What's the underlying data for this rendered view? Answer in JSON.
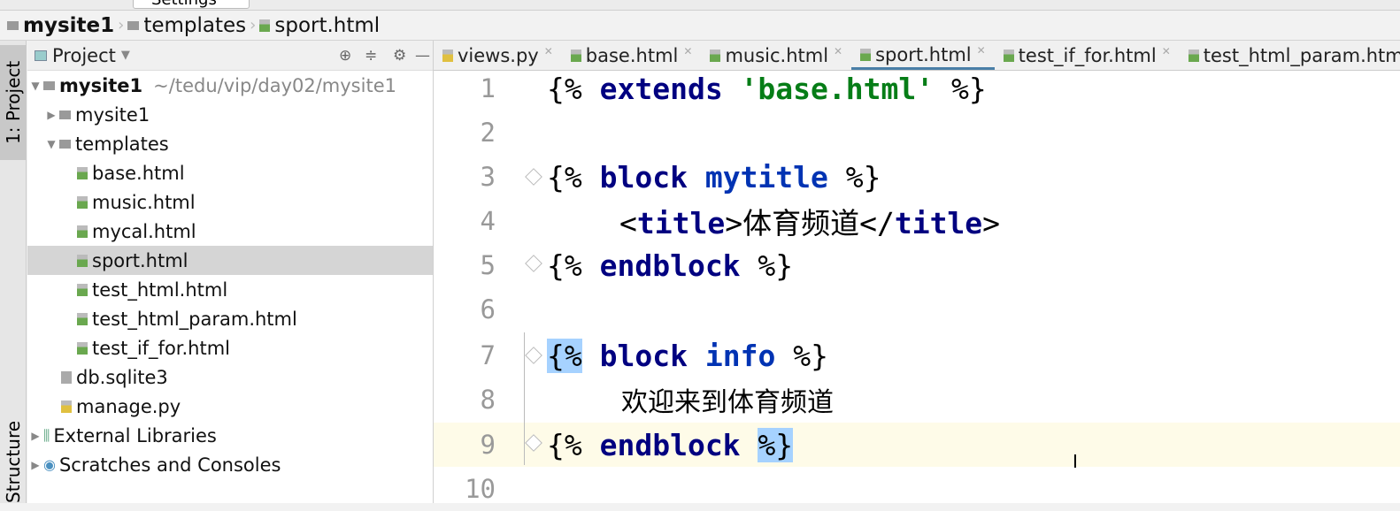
{
  "toolbar": {
    "run_config": "Settings"
  },
  "breadcrumb": [
    "mysite1",
    "templates",
    "sport.html"
  ],
  "sidebar_tabs": {
    "project": "1: Project",
    "structure": "Structure"
  },
  "project_panel": {
    "title": "Project",
    "root": {
      "name": "mysite1",
      "path": "~/tedu/vip/day02/mysite1"
    },
    "items": [
      {
        "label": "mysite1",
        "type": "folder",
        "level": 1,
        "expanded": false
      },
      {
        "label": "templates",
        "type": "folder",
        "level": 1,
        "expanded": true
      },
      {
        "label": "base.html",
        "type": "html",
        "level": 2
      },
      {
        "label": "music.html",
        "type": "html",
        "level": 2
      },
      {
        "label": "mycal.html",
        "type": "html",
        "level": 2
      },
      {
        "label": "sport.html",
        "type": "html",
        "level": 2,
        "selected": true
      },
      {
        "label": "test_html.html",
        "type": "html",
        "level": 2
      },
      {
        "label": "test_html_param.html",
        "type": "html",
        "level": 2
      },
      {
        "label": "test_if_for.html",
        "type": "html",
        "level": 2
      },
      {
        "label": "db.sqlite3",
        "type": "file",
        "level": 1
      },
      {
        "label": "manage.py",
        "type": "python",
        "level": 1
      }
    ],
    "extra": [
      "External Libraries",
      "Scratches and Consoles"
    ]
  },
  "tabs": [
    {
      "label": "views.py"
    },
    {
      "label": "base.html"
    },
    {
      "label": "music.html"
    },
    {
      "label": "sport.html",
      "active": true
    },
    {
      "label": "test_if_for.html"
    },
    {
      "label": "test_html_param.html"
    }
  ],
  "editor": {
    "current_line": 9,
    "line_numbers": [
      "1",
      "2",
      "3",
      "4",
      "5",
      "6",
      "7",
      "8",
      "9",
      "10"
    ],
    "l1": {
      "a": "{% ",
      "b": "extends",
      "c": " ",
      "d": "'base.html'",
      "e": " %}"
    },
    "l3": {
      "a": "{% ",
      "b": "block",
      "c": " ",
      "d": "mytitle",
      "e": " %}"
    },
    "l4": {
      "a": "<",
      "b": "title",
      "c": ">体育频道</",
      "d": "title",
      "e": ">"
    },
    "l5": {
      "a": "{% ",
      "b": "endblock",
      "c": " %}"
    },
    "l7": {
      "a": "{%",
      "b": " ",
      "c": "block",
      "d": " ",
      "e": "info",
      "f": " %}"
    },
    "l8": "欢迎来到体育频道",
    "l9": {
      "a": "{% ",
      "b": "endblock",
      "c": " ",
      "d": "%}"
    }
  }
}
